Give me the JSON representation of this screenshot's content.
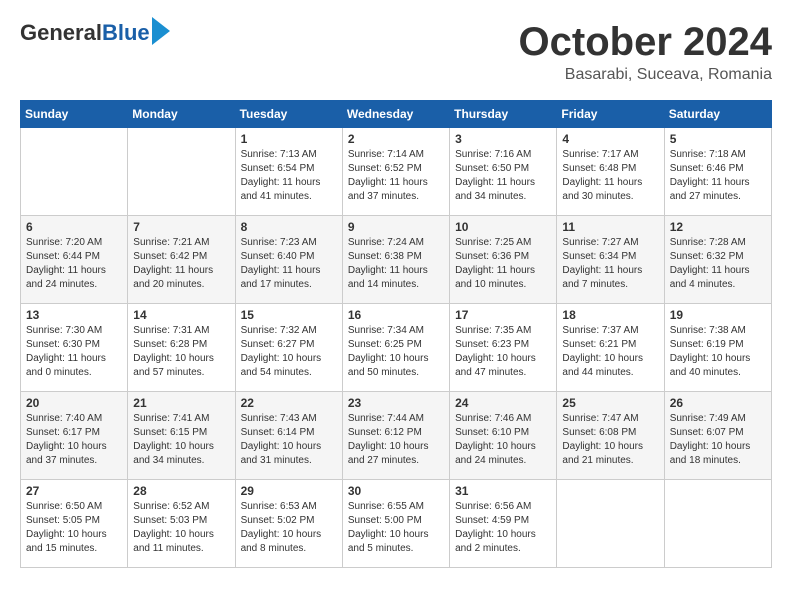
{
  "header": {
    "logo_general": "General",
    "logo_blue": "Blue",
    "month_title": "October 2024",
    "subtitle": "Basarabi, Suceava, Romania"
  },
  "days_of_week": [
    "Sunday",
    "Monday",
    "Tuesday",
    "Wednesday",
    "Thursday",
    "Friday",
    "Saturday"
  ],
  "weeks": [
    [
      {
        "day": "",
        "sunrise": "",
        "sunset": "",
        "daylight": ""
      },
      {
        "day": "",
        "sunrise": "",
        "sunset": "",
        "daylight": ""
      },
      {
        "day": "1",
        "sunrise": "Sunrise: 7:13 AM",
        "sunset": "Sunset: 6:54 PM",
        "daylight": "Daylight: 11 hours and 41 minutes."
      },
      {
        "day": "2",
        "sunrise": "Sunrise: 7:14 AM",
        "sunset": "Sunset: 6:52 PM",
        "daylight": "Daylight: 11 hours and 37 minutes."
      },
      {
        "day": "3",
        "sunrise": "Sunrise: 7:16 AM",
        "sunset": "Sunset: 6:50 PM",
        "daylight": "Daylight: 11 hours and 34 minutes."
      },
      {
        "day": "4",
        "sunrise": "Sunrise: 7:17 AM",
        "sunset": "Sunset: 6:48 PM",
        "daylight": "Daylight: 11 hours and 30 minutes."
      },
      {
        "day": "5",
        "sunrise": "Sunrise: 7:18 AM",
        "sunset": "Sunset: 6:46 PM",
        "daylight": "Daylight: 11 hours and 27 minutes."
      }
    ],
    [
      {
        "day": "6",
        "sunrise": "Sunrise: 7:20 AM",
        "sunset": "Sunset: 6:44 PM",
        "daylight": "Daylight: 11 hours and 24 minutes."
      },
      {
        "day": "7",
        "sunrise": "Sunrise: 7:21 AM",
        "sunset": "Sunset: 6:42 PM",
        "daylight": "Daylight: 11 hours and 20 minutes."
      },
      {
        "day": "8",
        "sunrise": "Sunrise: 7:23 AM",
        "sunset": "Sunset: 6:40 PM",
        "daylight": "Daylight: 11 hours and 17 minutes."
      },
      {
        "day": "9",
        "sunrise": "Sunrise: 7:24 AM",
        "sunset": "Sunset: 6:38 PM",
        "daylight": "Daylight: 11 hours and 14 minutes."
      },
      {
        "day": "10",
        "sunrise": "Sunrise: 7:25 AM",
        "sunset": "Sunset: 6:36 PM",
        "daylight": "Daylight: 11 hours and 10 minutes."
      },
      {
        "day": "11",
        "sunrise": "Sunrise: 7:27 AM",
        "sunset": "Sunset: 6:34 PM",
        "daylight": "Daylight: 11 hours and 7 minutes."
      },
      {
        "day": "12",
        "sunrise": "Sunrise: 7:28 AM",
        "sunset": "Sunset: 6:32 PM",
        "daylight": "Daylight: 11 hours and 4 minutes."
      }
    ],
    [
      {
        "day": "13",
        "sunrise": "Sunrise: 7:30 AM",
        "sunset": "Sunset: 6:30 PM",
        "daylight": "Daylight: 11 hours and 0 minutes."
      },
      {
        "day": "14",
        "sunrise": "Sunrise: 7:31 AM",
        "sunset": "Sunset: 6:28 PM",
        "daylight": "Daylight: 10 hours and 57 minutes."
      },
      {
        "day": "15",
        "sunrise": "Sunrise: 7:32 AM",
        "sunset": "Sunset: 6:27 PM",
        "daylight": "Daylight: 10 hours and 54 minutes."
      },
      {
        "day": "16",
        "sunrise": "Sunrise: 7:34 AM",
        "sunset": "Sunset: 6:25 PM",
        "daylight": "Daylight: 10 hours and 50 minutes."
      },
      {
        "day": "17",
        "sunrise": "Sunrise: 7:35 AM",
        "sunset": "Sunset: 6:23 PM",
        "daylight": "Daylight: 10 hours and 47 minutes."
      },
      {
        "day": "18",
        "sunrise": "Sunrise: 7:37 AM",
        "sunset": "Sunset: 6:21 PM",
        "daylight": "Daylight: 10 hours and 44 minutes."
      },
      {
        "day": "19",
        "sunrise": "Sunrise: 7:38 AM",
        "sunset": "Sunset: 6:19 PM",
        "daylight": "Daylight: 10 hours and 40 minutes."
      }
    ],
    [
      {
        "day": "20",
        "sunrise": "Sunrise: 7:40 AM",
        "sunset": "Sunset: 6:17 PM",
        "daylight": "Daylight: 10 hours and 37 minutes."
      },
      {
        "day": "21",
        "sunrise": "Sunrise: 7:41 AM",
        "sunset": "Sunset: 6:15 PM",
        "daylight": "Daylight: 10 hours and 34 minutes."
      },
      {
        "day": "22",
        "sunrise": "Sunrise: 7:43 AM",
        "sunset": "Sunset: 6:14 PM",
        "daylight": "Daylight: 10 hours and 31 minutes."
      },
      {
        "day": "23",
        "sunrise": "Sunrise: 7:44 AM",
        "sunset": "Sunset: 6:12 PM",
        "daylight": "Daylight: 10 hours and 27 minutes."
      },
      {
        "day": "24",
        "sunrise": "Sunrise: 7:46 AM",
        "sunset": "Sunset: 6:10 PM",
        "daylight": "Daylight: 10 hours and 24 minutes."
      },
      {
        "day": "25",
        "sunrise": "Sunrise: 7:47 AM",
        "sunset": "Sunset: 6:08 PM",
        "daylight": "Daylight: 10 hours and 21 minutes."
      },
      {
        "day": "26",
        "sunrise": "Sunrise: 7:49 AM",
        "sunset": "Sunset: 6:07 PM",
        "daylight": "Daylight: 10 hours and 18 minutes."
      }
    ],
    [
      {
        "day": "27",
        "sunrise": "Sunrise: 6:50 AM",
        "sunset": "Sunset: 5:05 PM",
        "daylight": "Daylight: 10 hours and 15 minutes."
      },
      {
        "day": "28",
        "sunrise": "Sunrise: 6:52 AM",
        "sunset": "Sunset: 5:03 PM",
        "daylight": "Daylight: 10 hours and 11 minutes."
      },
      {
        "day": "29",
        "sunrise": "Sunrise: 6:53 AM",
        "sunset": "Sunset: 5:02 PM",
        "daylight": "Daylight: 10 hours and 8 minutes."
      },
      {
        "day": "30",
        "sunrise": "Sunrise: 6:55 AM",
        "sunset": "Sunset: 5:00 PM",
        "daylight": "Daylight: 10 hours and 5 minutes."
      },
      {
        "day": "31",
        "sunrise": "Sunrise: 6:56 AM",
        "sunset": "Sunset: 4:59 PM",
        "daylight": "Daylight: 10 hours and 2 minutes."
      },
      {
        "day": "",
        "sunrise": "",
        "sunset": "",
        "daylight": ""
      },
      {
        "day": "",
        "sunrise": "",
        "sunset": "",
        "daylight": ""
      }
    ]
  ]
}
